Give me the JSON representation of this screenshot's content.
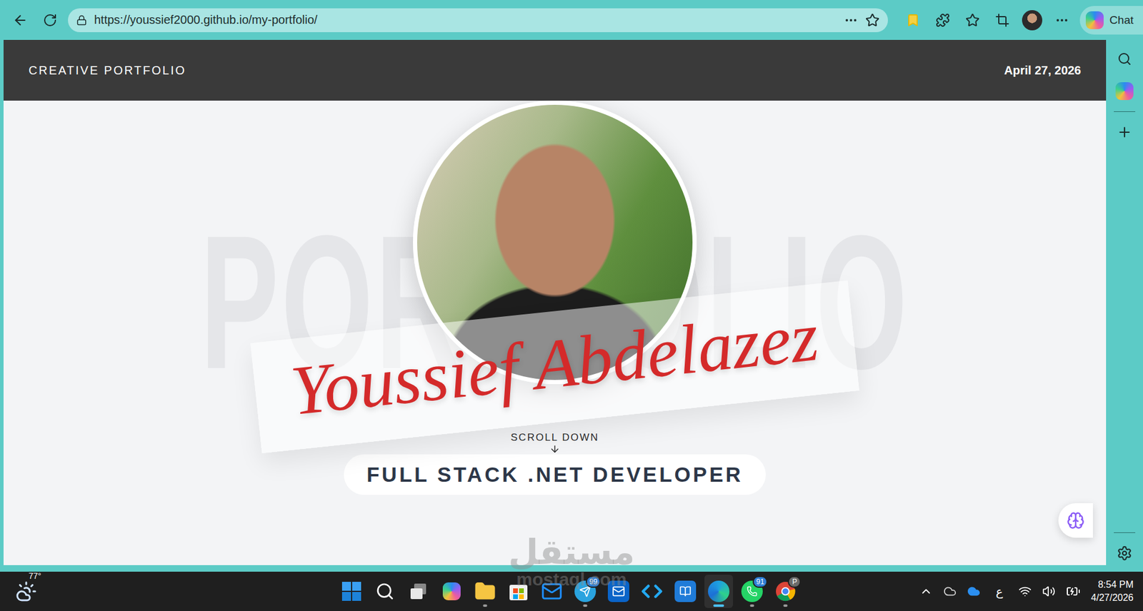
{
  "browser": {
    "url": "https://youssief2000.github.io/my-portfolio/",
    "chat_button": "Chat"
  },
  "page": {
    "header": {
      "brand": "CREATIVE PORTFOLIO",
      "date": "April 27, 2026"
    },
    "hero": {
      "watermark": "PORTFOLIO",
      "name": "Youssief Abdelazez",
      "scroll_hint": "SCROLL DOWN",
      "role": "FULL STACK .NET DEVELOPER"
    }
  },
  "overlay_watermark": {
    "arabic": "مستقل",
    "latin": "mostaql.com"
  },
  "taskbar": {
    "weather": "77°",
    "apps": [
      {
        "kind": "start",
        "running": false,
        "active": false,
        "badge": "",
        "badge_color": "#0078d4"
      },
      {
        "kind": "search",
        "running": false,
        "active": false,
        "badge": "",
        "badge_color": "#0078d4"
      },
      {
        "kind": "taskview",
        "running": false,
        "active": false,
        "badge": "",
        "badge_color": "#0078d4"
      },
      {
        "kind": "copilot",
        "running": false,
        "active": false,
        "badge": "",
        "badge_color": "#0078d4"
      },
      {
        "kind": "files",
        "running": true,
        "active": false,
        "badge": "",
        "badge_color": "#0078d4"
      },
      {
        "kind": "store",
        "running": false,
        "active": false,
        "badge": "",
        "badge_color": "#0078d4"
      },
      {
        "kind": "mail",
        "running": false,
        "active": false,
        "badge": "",
        "badge_color": "#0078d4"
      },
      {
        "kind": "telegram",
        "running": true,
        "active": false,
        "badge": "99",
        "badge_color": "#2f7fd6"
      },
      {
        "kind": "outlook",
        "running": false,
        "active": false,
        "badge": "",
        "badge_color": "#0078d4"
      },
      {
        "kind": "vscode",
        "running": false,
        "active": false,
        "badge": "",
        "badge_color": "#0078d4"
      },
      {
        "kind": "codeblocks",
        "running": false,
        "active": false,
        "badge": "",
        "badge_color": "#0078d4"
      },
      {
        "kind": "edge",
        "running": true,
        "active": true,
        "badge": "",
        "badge_color": "#0078d4"
      },
      {
        "kind": "whatsapp",
        "running": true,
        "active": false,
        "badge": "91",
        "badge_color": "#2f7fd6"
      },
      {
        "kind": "chrome",
        "running": true,
        "active": false,
        "badge": "P",
        "badge_color": "#6b6b6b"
      }
    ],
    "tray": {
      "language": "ع",
      "time": "8:54 PM",
      "date": "4/27/2026"
    }
  }
}
